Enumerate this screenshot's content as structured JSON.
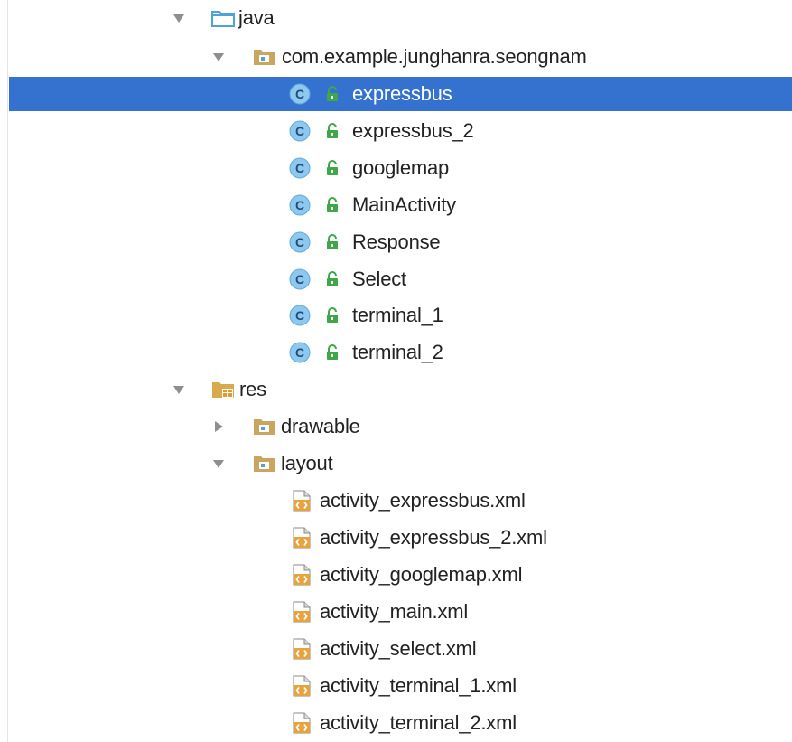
{
  "tree": {
    "java": {
      "label": "java",
      "expanded": true,
      "icon": "folder-icon"
    },
    "package": {
      "label": "com.example.junghanra.seongnam",
      "expanded": true,
      "icon": "package-folder-icon"
    },
    "classes": [
      {
        "label": "expressbus",
        "selected": true,
        "icon": "class-icon",
        "access": "public"
      },
      {
        "label": "expressbus_2",
        "icon": "class-icon",
        "access": "public"
      },
      {
        "label": "googlemap",
        "icon": "class-icon",
        "access": "public"
      },
      {
        "label": "MainActivity",
        "icon": "class-icon",
        "access": "public"
      },
      {
        "label": "Response",
        "icon": "class-icon",
        "access": "public"
      },
      {
        "label": "Select",
        "icon": "class-icon",
        "access": "public"
      },
      {
        "label": "terminal_1",
        "icon": "class-icon",
        "access": "public"
      },
      {
        "label": "terminal_2",
        "icon": "class-icon",
        "access": "public"
      }
    ],
    "res": {
      "label": "res",
      "expanded": true,
      "icon": "resource-folder-icon"
    },
    "drawable": {
      "label": "drawable",
      "expanded": false,
      "icon": "folder-icon"
    },
    "layout": {
      "label": "layout",
      "expanded": true,
      "icon": "folder-icon"
    },
    "layout_files": [
      {
        "label": "activity_expressbus.xml",
        "icon": "xml-file-icon"
      },
      {
        "label": "activity_expressbus_2.xml",
        "icon": "xml-file-icon"
      },
      {
        "label": "activity_googlemap.xml",
        "icon": "xml-file-icon"
      },
      {
        "label": "activity_main.xml",
        "icon": "xml-file-icon"
      },
      {
        "label": "activity_select.xml",
        "icon": "xml-file-icon"
      },
      {
        "label": "activity_terminal_1.xml",
        "icon": "xml-file-icon"
      },
      {
        "label": "activity_terminal_2.xml",
        "icon": "xml-file-icon"
      }
    ]
  },
  "colors": {
    "selection": "#3572d0",
    "folder_blue": "#5aaad8",
    "folder_tan": "#c9a45a",
    "class_circle": "#8cc4ec",
    "lock_green": "#3fa64a",
    "xml_orange": "#e8a33d"
  }
}
